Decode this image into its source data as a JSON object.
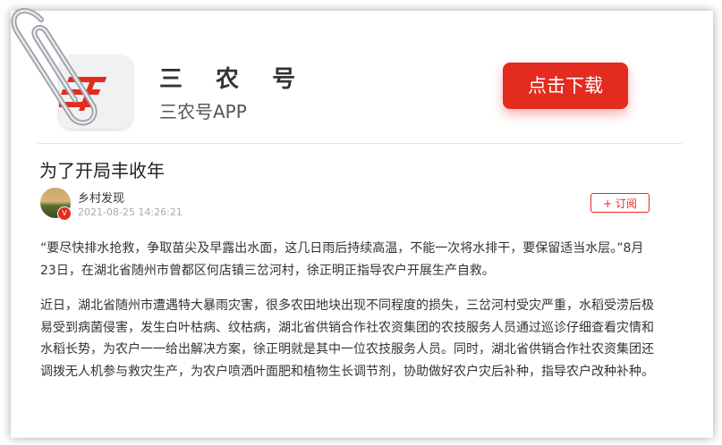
{
  "app": {
    "name": "三 农 号",
    "subtitle": "三农号APP",
    "download_label": "点击下载",
    "logo_text": "三农号"
  },
  "article": {
    "title": "为了开局丰收年",
    "author": {
      "name": "乡村发现",
      "time": "2021-08-25 14:26:21",
      "badge": "V",
      "follow_label": "+ 订阅"
    },
    "paragraphs": [
      "“要尽快排水抢救，争取苗尖及早露出水面，这几日雨后持续高温，不能一次将水排干，要保留适当水层。”8月23日，在湖北省随州市曾都区何店镇三岔河村，徐正明正指导农户开展生产自救。",
      "近日，湖北省随州市遭遇特大暴雨灾害，很多农田地块出现不同程度的损失，三岔河村受灾严重，水稻受涝后极易受到病菌侵害，发生白叶枯病、纹枯病，湖北省供销合作社农资集团的农技服务人员通过巡诊仔细查看灾情和水稻长势，为农户一一给出解决方案，徐正明就是其中一位农技服务人员。同时，湖北省供销合作社农资集团还调拨无人机参与救灾生产，为农户喷洒叶面肥和植物生长调节剂，协助做好农户灾后补种，指导农户改种补种。"
    ]
  },
  "icons": {
    "paperclip": "paperclip-icon",
    "logo": "app-logo-icon"
  },
  "colors": {
    "accent": "#e42b1f",
    "text": "#333333",
    "muted": "#aaaaaa"
  }
}
